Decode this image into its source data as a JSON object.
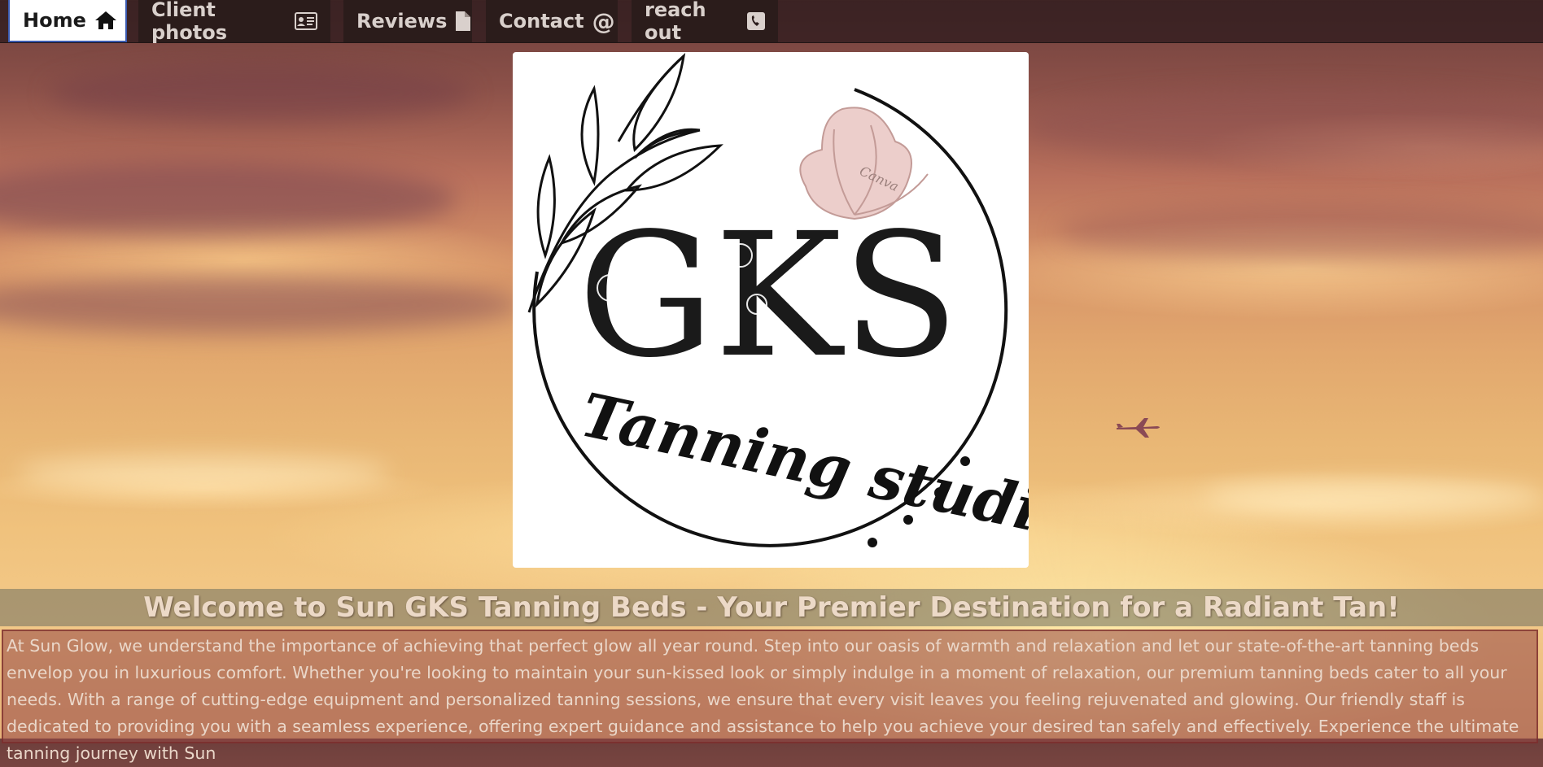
{
  "nav": {
    "items": [
      {
        "label": "Home",
        "icon": "home-icon",
        "active": true
      },
      {
        "label": "Client photos",
        "icon": "id-card-icon",
        "active": false
      },
      {
        "label": "Reviews",
        "icon": "file-icon",
        "active": false
      },
      {
        "label": "Contact",
        "icon": "at-sign-icon",
        "active": false
      },
      {
        "label": "reach out",
        "icon": "phone-square-icon",
        "active": false
      }
    ]
  },
  "logo": {
    "letters": "GKS",
    "tagline": "Tanning studio",
    "watermark": "Canva"
  },
  "main": {
    "heading": "Welcome to Sun GKS Tanning Beds - Your Premier Destination for a Radiant Tan!",
    "intro": "At Sun Glow, we understand the importance of achieving that perfect glow all year round. Step into our oasis of warmth and relaxation and let our state-of-the-art tanning beds envelop you in luxurious comfort. Whether you're looking to maintain your sun-kissed look or simply indulge in a moment of relaxation, our premium tanning beds cater to all your needs. With a range of cutting-edge equipment and personalized tanning sessions, we ensure that every visit leaves you feeling rejuvenated and glowing. Our friendly staff is dedicated to providing you with a seamless experience, offering expert guidance and assistance to help you achieve your desired tan safely and effectively. Experience the ultimate tanning journey with Sun"
  },
  "colors": {
    "nav_bg": "#2b1c1b",
    "nav_text": "#d9d0cc",
    "active_tab_bg": "#ffffff",
    "heading_text": "#ecd9c7",
    "intro_bg": "#964846"
  }
}
